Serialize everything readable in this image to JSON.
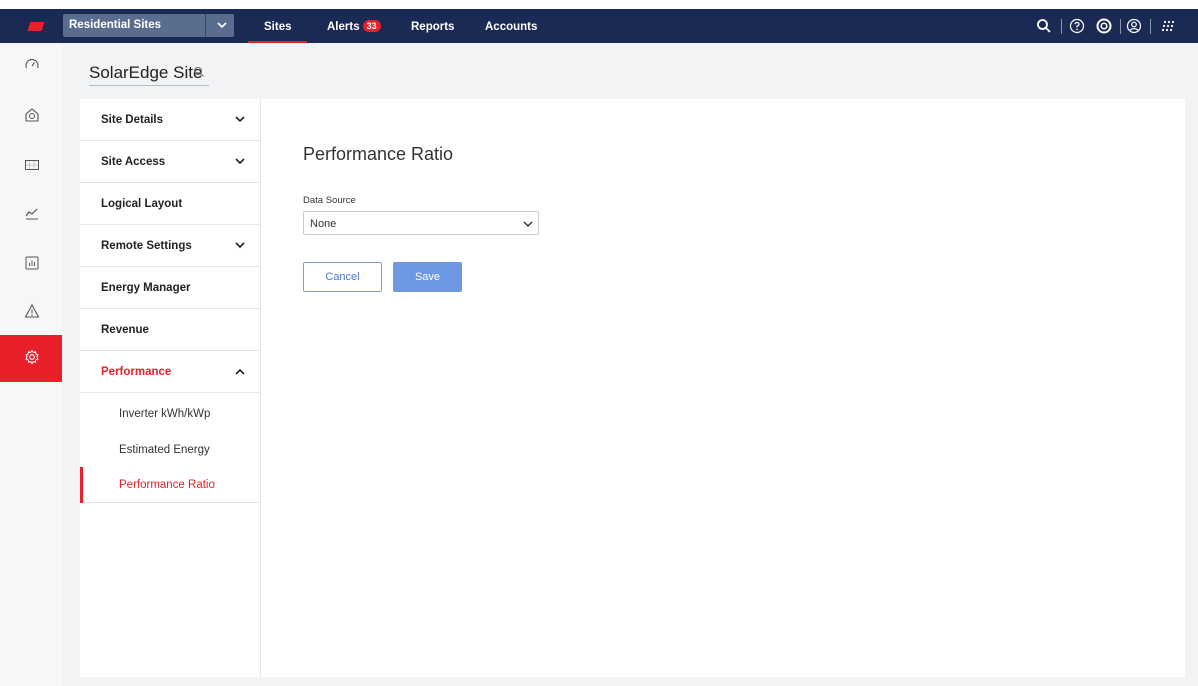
{
  "topbar": {
    "site_selector": "Residential Sites",
    "nav": {
      "sites": "Sites",
      "alerts": "Alerts",
      "alerts_count": "33",
      "reports": "Reports",
      "accounts": "Accounts"
    },
    "icons": [
      "search-icon",
      "help-icon",
      "support-icon",
      "user-icon",
      "apps-grid-icon"
    ],
    "brand_color": "#e8202a",
    "bar_color": "#1b2a55"
  },
  "rail": {
    "items": [
      "dashboard-icon",
      "site-layout-icon",
      "panel-layout-icon",
      "charts-icon",
      "reports-icon",
      "alerts-icon",
      "settings-icon"
    ],
    "active": "settings-icon"
  },
  "site": {
    "title": "SolarEdge Site"
  },
  "menu": {
    "site_details": "Site Details",
    "site_access": "Site Access",
    "logical_layout": "Logical Layout",
    "remote_settings": "Remote Settings",
    "energy_manager": "Energy Manager",
    "revenue": "Revenue",
    "performance": "Performance",
    "sub": {
      "inverter": "Inverter kWh/kWp",
      "estimated": "Estimated Energy",
      "ratio": "Performance Ratio"
    }
  },
  "main": {
    "heading": "Performance Ratio",
    "data_source_label": "Data Source",
    "data_source_value": "None",
    "cancel": "Cancel",
    "save": "Save"
  }
}
